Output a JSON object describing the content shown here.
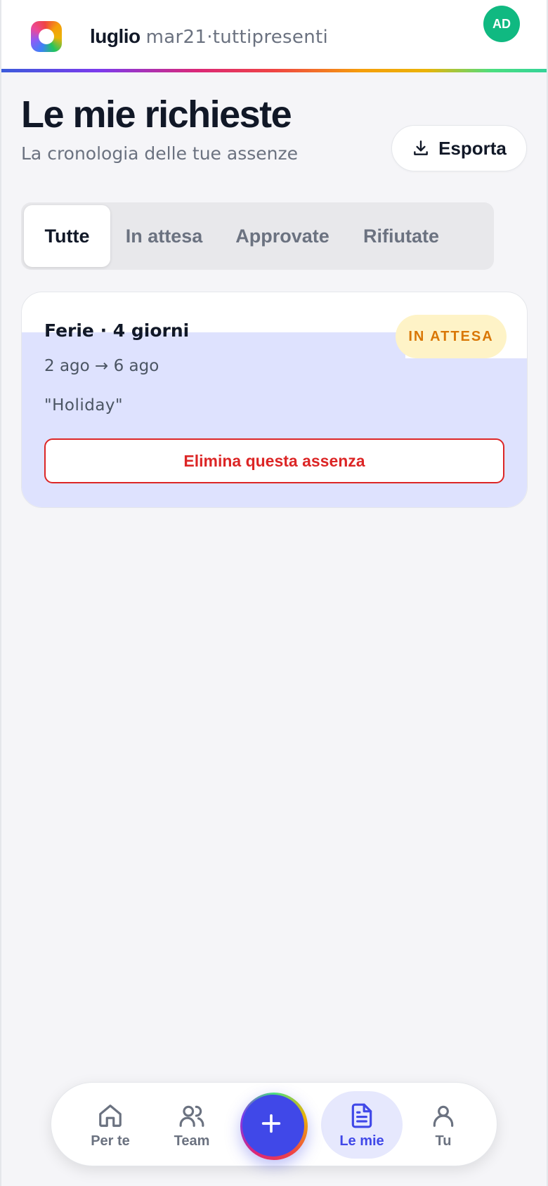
{
  "header": {
    "month": "luglio",
    "meta": "mar21·tuttipresenti",
    "avatar_initials": "AD"
  },
  "page": {
    "title": "Le mie richieste",
    "subtitle": "La cronologia delle tue assenze",
    "export_label": "Esporta"
  },
  "tabs": [
    {
      "label": "Tutte",
      "active": true
    },
    {
      "label": "In attesa",
      "active": false
    },
    {
      "label": "Approvate",
      "active": false
    },
    {
      "label": "Rifiutate",
      "active": false
    }
  ],
  "requests": [
    {
      "title": "Ferie · 4 giorni",
      "status": "IN ATTESA",
      "dates": "2 ago → 6 ago",
      "note": "\"Holiday\"",
      "delete_label": "Elimina questa assenza"
    }
  ],
  "bottom_nav": [
    {
      "label": "Per te",
      "icon": "home-icon"
    },
    {
      "label": "Team",
      "icon": "users-icon"
    },
    {
      "label": "Le mie",
      "icon": "document-icon",
      "active": true
    },
    {
      "label": "Tu",
      "icon": "user-icon"
    }
  ],
  "fab": {
    "icon": "plus-icon"
  },
  "colors": {
    "accent": "#4048e8",
    "avatar": "#10b981",
    "pending_bg": "#fef3c7",
    "pending_text": "#d97706",
    "danger": "#dc2626",
    "highlight": "#dee2fe"
  }
}
